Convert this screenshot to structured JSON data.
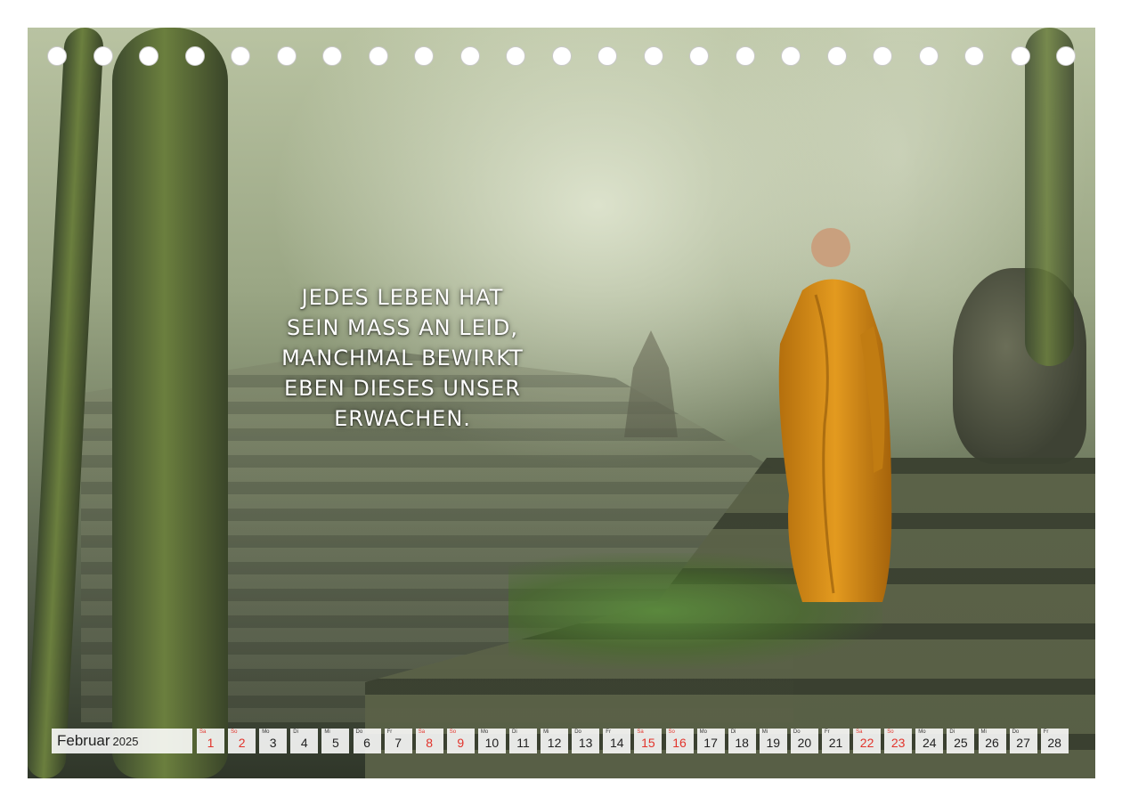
{
  "quote": {
    "lines": [
      "JEDES LEBEN HAT",
      "SEIN MASS AN LEID,",
      "MANCHMAL BEWIRKT",
      "EBEN DIESES UNSER",
      "ERWACHEN."
    ]
  },
  "calendar": {
    "month": "Februar",
    "year": "2025",
    "weekend_color": "#e2332b",
    "days": [
      {
        "wd": "Sa",
        "num": "1",
        "weekend": true
      },
      {
        "wd": "So",
        "num": "2",
        "weekend": true
      },
      {
        "wd": "Mo",
        "num": "3",
        "weekend": false
      },
      {
        "wd": "Di",
        "num": "4",
        "weekend": false
      },
      {
        "wd": "Mi",
        "num": "5",
        "weekend": false
      },
      {
        "wd": "Do",
        "num": "6",
        "weekend": false
      },
      {
        "wd": "Fr",
        "num": "7",
        "weekend": false
      },
      {
        "wd": "Sa",
        "num": "8",
        "weekend": true
      },
      {
        "wd": "So",
        "num": "9",
        "weekend": true
      },
      {
        "wd": "Mo",
        "num": "10",
        "weekend": false
      },
      {
        "wd": "Di",
        "num": "11",
        "weekend": false
      },
      {
        "wd": "Mi",
        "num": "12",
        "weekend": false
      },
      {
        "wd": "Do",
        "num": "13",
        "weekend": false
      },
      {
        "wd": "Fr",
        "num": "14",
        "weekend": false
      },
      {
        "wd": "Sa",
        "num": "15",
        "weekend": true
      },
      {
        "wd": "So",
        "num": "16",
        "weekend": true
      },
      {
        "wd": "Mo",
        "num": "17",
        "weekend": false
      },
      {
        "wd": "Di",
        "num": "18",
        "weekend": false
      },
      {
        "wd": "Mi",
        "num": "19",
        "weekend": false
      },
      {
        "wd": "Do",
        "num": "20",
        "weekend": false
      },
      {
        "wd": "Fr",
        "num": "21",
        "weekend": false
      },
      {
        "wd": "Sa",
        "num": "22",
        "weekend": true
      },
      {
        "wd": "So",
        "num": "23",
        "weekend": true
      },
      {
        "wd": "Mo",
        "num": "24",
        "weekend": false
      },
      {
        "wd": "Di",
        "num": "25",
        "weekend": false
      },
      {
        "wd": "Mi",
        "num": "26",
        "weekend": false
      },
      {
        "wd": "Do",
        "num": "27",
        "weekend": false
      },
      {
        "wd": "Fr",
        "num": "28",
        "weekend": false
      }
    ]
  }
}
